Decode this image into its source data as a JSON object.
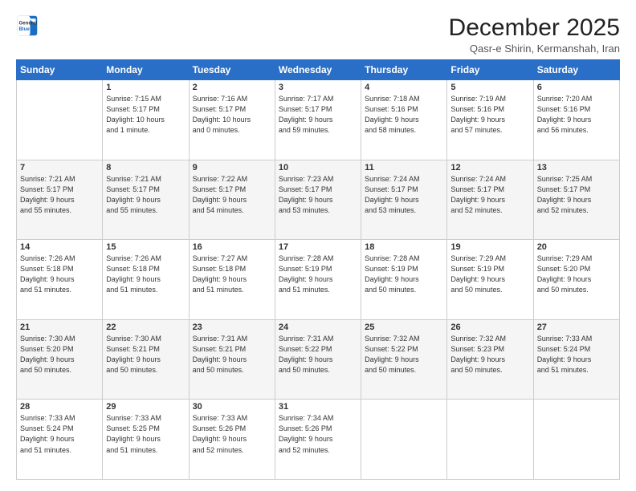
{
  "logo": {
    "line1": "General",
    "line2": "Blue"
  },
  "title": "December 2025",
  "location": "Qasr-e Shirin, Kermanshah, Iran",
  "weekdays": [
    "Sunday",
    "Monday",
    "Tuesday",
    "Wednesday",
    "Thursday",
    "Friday",
    "Saturday"
  ],
  "weeks": [
    [
      {
        "day": "",
        "info": ""
      },
      {
        "day": "1",
        "info": "Sunrise: 7:15 AM\nSunset: 5:17 PM\nDaylight: 10 hours\nand 1 minute."
      },
      {
        "day": "2",
        "info": "Sunrise: 7:16 AM\nSunset: 5:17 PM\nDaylight: 10 hours\nand 0 minutes."
      },
      {
        "day": "3",
        "info": "Sunrise: 7:17 AM\nSunset: 5:17 PM\nDaylight: 9 hours\nand 59 minutes."
      },
      {
        "day": "4",
        "info": "Sunrise: 7:18 AM\nSunset: 5:16 PM\nDaylight: 9 hours\nand 58 minutes."
      },
      {
        "day": "5",
        "info": "Sunrise: 7:19 AM\nSunset: 5:16 PM\nDaylight: 9 hours\nand 57 minutes."
      },
      {
        "day": "6",
        "info": "Sunrise: 7:20 AM\nSunset: 5:16 PM\nDaylight: 9 hours\nand 56 minutes."
      }
    ],
    [
      {
        "day": "7",
        "info": "Sunrise: 7:21 AM\nSunset: 5:17 PM\nDaylight: 9 hours\nand 55 minutes."
      },
      {
        "day": "8",
        "info": "Sunrise: 7:21 AM\nSunset: 5:17 PM\nDaylight: 9 hours\nand 55 minutes."
      },
      {
        "day": "9",
        "info": "Sunrise: 7:22 AM\nSunset: 5:17 PM\nDaylight: 9 hours\nand 54 minutes."
      },
      {
        "day": "10",
        "info": "Sunrise: 7:23 AM\nSunset: 5:17 PM\nDaylight: 9 hours\nand 53 minutes."
      },
      {
        "day": "11",
        "info": "Sunrise: 7:24 AM\nSunset: 5:17 PM\nDaylight: 9 hours\nand 53 minutes."
      },
      {
        "day": "12",
        "info": "Sunrise: 7:24 AM\nSunset: 5:17 PM\nDaylight: 9 hours\nand 52 minutes."
      },
      {
        "day": "13",
        "info": "Sunrise: 7:25 AM\nSunset: 5:17 PM\nDaylight: 9 hours\nand 52 minutes."
      }
    ],
    [
      {
        "day": "14",
        "info": "Sunrise: 7:26 AM\nSunset: 5:18 PM\nDaylight: 9 hours\nand 51 minutes."
      },
      {
        "day": "15",
        "info": "Sunrise: 7:26 AM\nSunset: 5:18 PM\nDaylight: 9 hours\nand 51 minutes."
      },
      {
        "day": "16",
        "info": "Sunrise: 7:27 AM\nSunset: 5:18 PM\nDaylight: 9 hours\nand 51 minutes."
      },
      {
        "day": "17",
        "info": "Sunrise: 7:28 AM\nSunset: 5:19 PM\nDaylight: 9 hours\nand 51 minutes."
      },
      {
        "day": "18",
        "info": "Sunrise: 7:28 AM\nSunset: 5:19 PM\nDaylight: 9 hours\nand 50 minutes."
      },
      {
        "day": "19",
        "info": "Sunrise: 7:29 AM\nSunset: 5:19 PM\nDaylight: 9 hours\nand 50 minutes."
      },
      {
        "day": "20",
        "info": "Sunrise: 7:29 AM\nSunset: 5:20 PM\nDaylight: 9 hours\nand 50 minutes."
      }
    ],
    [
      {
        "day": "21",
        "info": "Sunrise: 7:30 AM\nSunset: 5:20 PM\nDaylight: 9 hours\nand 50 minutes."
      },
      {
        "day": "22",
        "info": "Sunrise: 7:30 AM\nSunset: 5:21 PM\nDaylight: 9 hours\nand 50 minutes."
      },
      {
        "day": "23",
        "info": "Sunrise: 7:31 AM\nSunset: 5:21 PM\nDaylight: 9 hours\nand 50 minutes."
      },
      {
        "day": "24",
        "info": "Sunrise: 7:31 AM\nSunset: 5:22 PM\nDaylight: 9 hours\nand 50 minutes."
      },
      {
        "day": "25",
        "info": "Sunrise: 7:32 AM\nSunset: 5:22 PM\nDaylight: 9 hours\nand 50 minutes."
      },
      {
        "day": "26",
        "info": "Sunrise: 7:32 AM\nSunset: 5:23 PM\nDaylight: 9 hours\nand 50 minutes."
      },
      {
        "day": "27",
        "info": "Sunrise: 7:33 AM\nSunset: 5:24 PM\nDaylight: 9 hours\nand 51 minutes."
      }
    ],
    [
      {
        "day": "28",
        "info": "Sunrise: 7:33 AM\nSunset: 5:24 PM\nDaylight: 9 hours\nand 51 minutes."
      },
      {
        "day": "29",
        "info": "Sunrise: 7:33 AM\nSunset: 5:25 PM\nDaylight: 9 hours\nand 51 minutes."
      },
      {
        "day": "30",
        "info": "Sunrise: 7:33 AM\nSunset: 5:26 PM\nDaylight: 9 hours\nand 52 minutes."
      },
      {
        "day": "31",
        "info": "Sunrise: 7:34 AM\nSunset: 5:26 PM\nDaylight: 9 hours\nand 52 minutes."
      },
      {
        "day": "",
        "info": ""
      },
      {
        "day": "",
        "info": ""
      },
      {
        "day": "",
        "info": ""
      }
    ]
  ]
}
